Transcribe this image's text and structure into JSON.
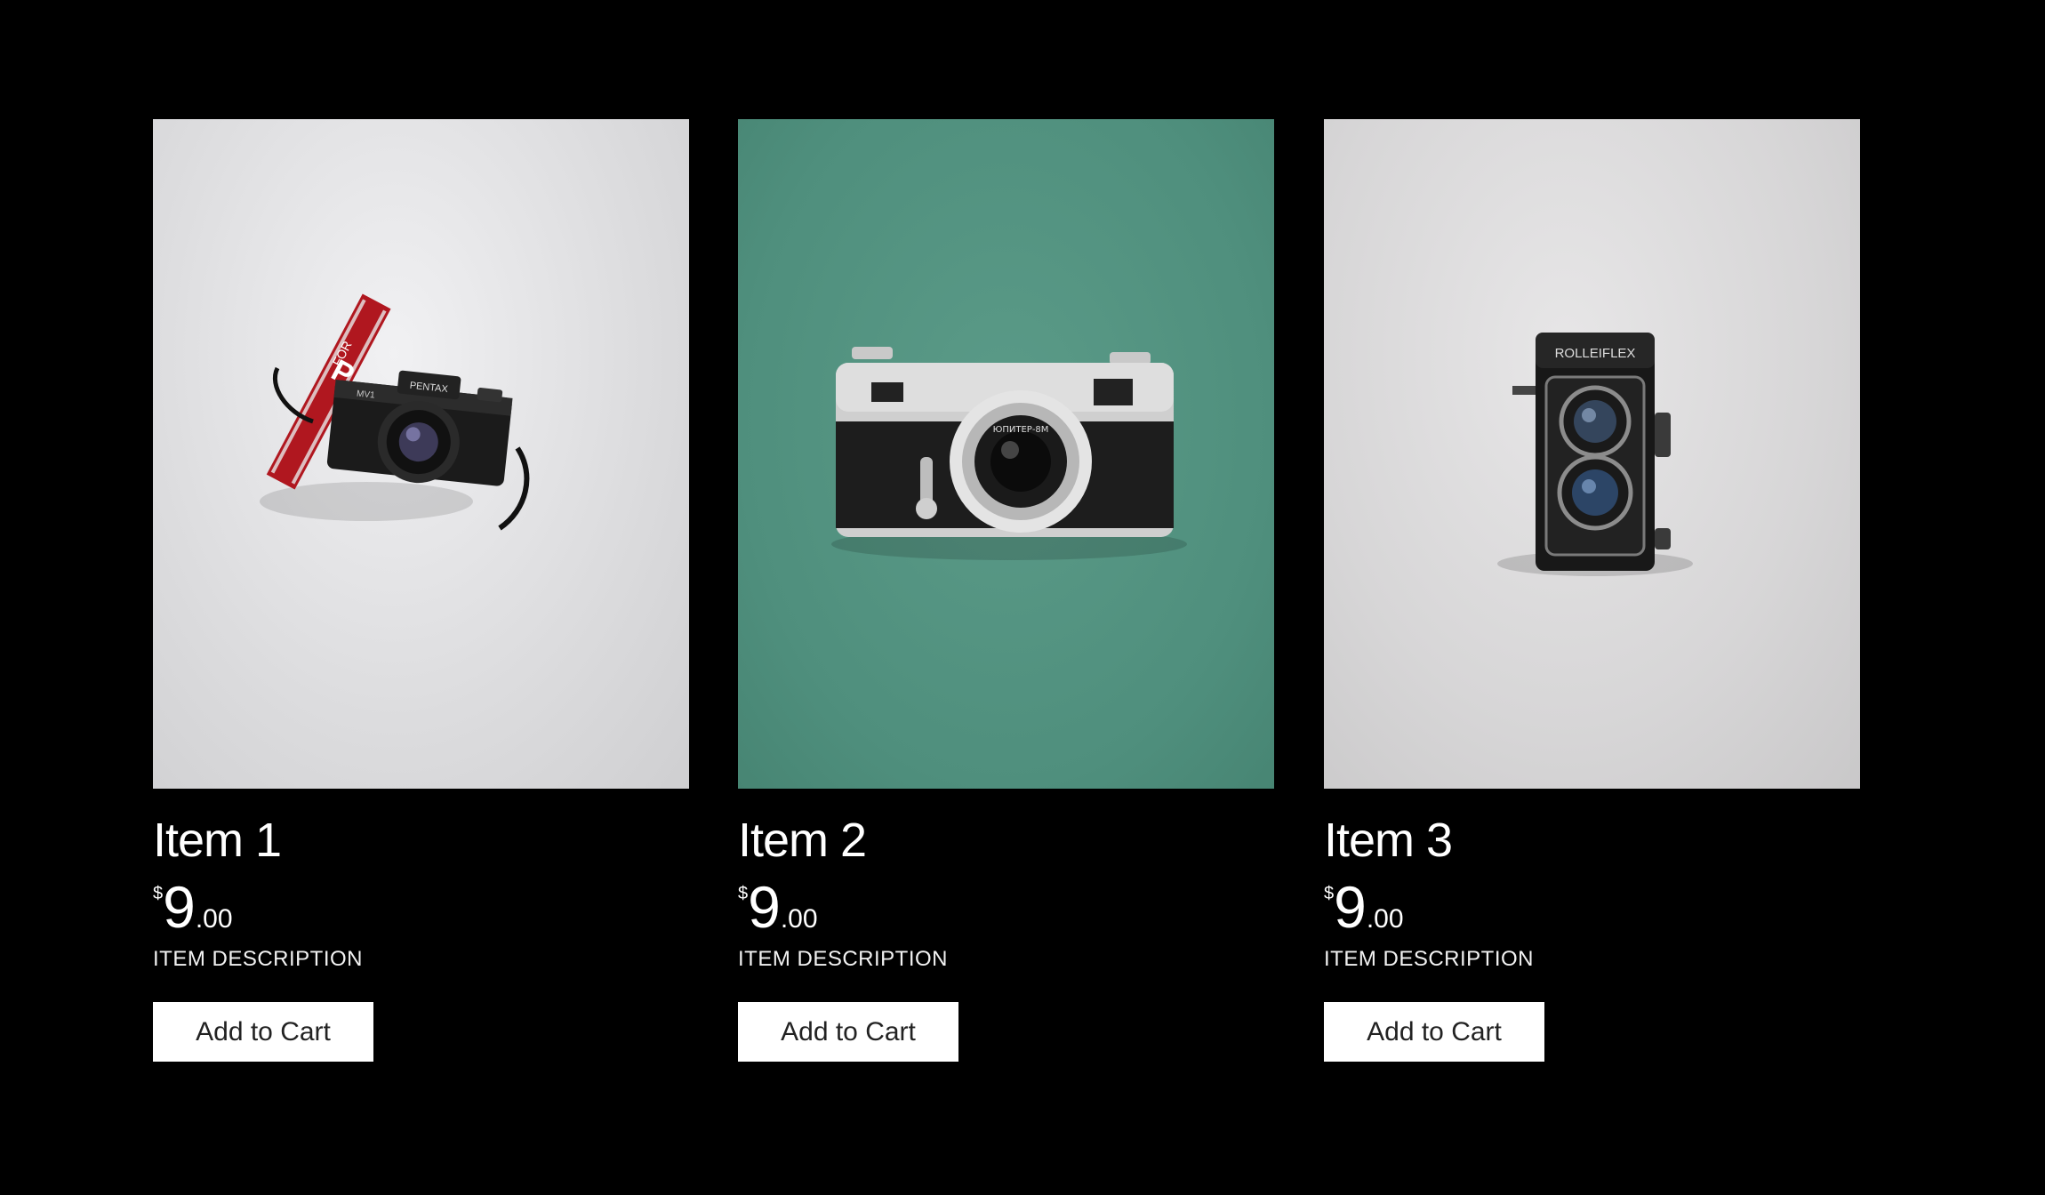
{
  "products": [
    {
      "title": "Item 1",
      "currency": "$",
      "price_whole": "9",
      "price_cents": ".00",
      "description": "ITEM DESCRIPTION",
      "button_label": "Add to Cart",
      "image_bg": "#dcdcde",
      "image_subject": "pentax-film-camera"
    },
    {
      "title": "Item 2",
      "currency": "$",
      "price_whole": "9",
      "price_cents": ".00",
      "description": "ITEM DESCRIPTION",
      "button_label": "Add to Cart",
      "image_bg": "#4f8f7d",
      "image_subject": "kiev-rangefinder-camera"
    },
    {
      "title": "Item 3",
      "currency": "$",
      "price_whole": "9",
      "price_cents": ".00",
      "description": "ITEM DESCRIPTION",
      "button_label": "Add to Cart",
      "image_bg": "#d7d6d7",
      "image_subject": "rolleiflex-twin-lens-camera"
    }
  ],
  "image_text": {
    "pentax_brand": "PENTAX",
    "pentax_model": "MV1",
    "strap_text": "FOR",
    "strap_letter": "P",
    "kiev_lens": "ЮПИТЕР-8М",
    "rollei_brand": "ROLLEIFLEX"
  },
  "colors": {
    "background": "#000000",
    "button_bg": "#ffffff",
    "button_text": "#222222",
    "text": "#ffffff"
  }
}
